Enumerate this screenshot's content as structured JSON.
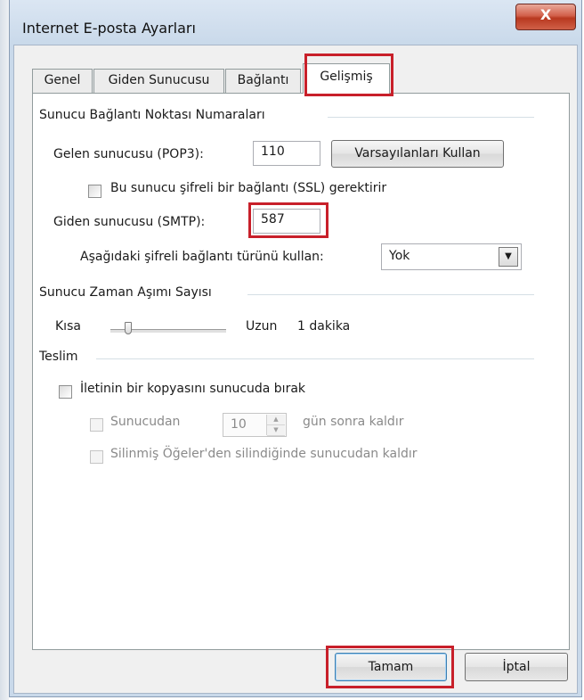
{
  "window": {
    "title": "Internet E-posta Ayarları",
    "close_glyph": "X"
  },
  "tabs": [
    {
      "label": "Genel"
    },
    {
      "label": "Giden Sunucusu"
    },
    {
      "label": "Bağlantı"
    },
    {
      "label": "Gelişmiş",
      "active": true
    }
  ],
  "server_ports": {
    "heading": "Sunucu Bağlantı Noktası Numaraları",
    "incoming_label": "Gelen sunucusu (POP3):",
    "incoming_value": "110",
    "defaults_button": "Varsayılanları Kullan",
    "ssl_checkbox_label": "Bu sunucu şifreli bir bağlantı (SSL) gerektirir",
    "ssl_checked": false,
    "outgoing_label": "Giden sunucusu (SMTP):",
    "outgoing_value": "587",
    "encryption_label": "Aşağıdaki şifreli bağlantı türünü kullan:",
    "encryption_value": "Yok"
  },
  "timeout": {
    "heading": "Sunucu Zaman Aşımı Sayısı",
    "short_label": "Kısa",
    "long_label": "Uzun",
    "value_label": "1 dakika"
  },
  "delivery": {
    "heading": "Teslim",
    "leave_copy_label": "İletinin bir kopyasını sunucuda bırak",
    "leave_copy_checked": false,
    "remove_after_label": "Sunucudan",
    "remove_after_days": "10",
    "remove_after_suffix": "gün sonra kaldır",
    "remove_deleted_label": "Silinmiş Öğeler'den silindiğinde sunucudan kaldır"
  },
  "footer": {
    "ok_label": "Tamam",
    "cancel_label": "İptal"
  },
  "colors": {
    "highlight_box": "#c8202a",
    "close_button": "#c64a33"
  }
}
